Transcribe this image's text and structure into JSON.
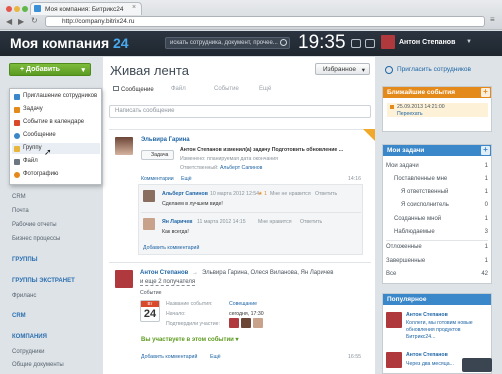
{
  "browser": {
    "tab_title": "Моя компания: Битрикс24",
    "tab_close": "×",
    "url": "http://company.bitrix24.ru",
    "nav_back": "◀",
    "nav_forward": "▶",
    "nav_reload": "↻",
    "menu": "≡"
  },
  "header": {
    "logo_text": "Моя компания",
    "logo_num": "24",
    "search_placeholder": "искать сотрудника, документ, прочее...",
    "clock": "19:35",
    "user_name": "Антон Степанов"
  },
  "left": {
    "add_button": "Добавить",
    "menu_items": [
      "CRM",
      "Почта",
      "Рабочие отчеты",
      "Бизнес процессы"
    ],
    "sections": [
      "ГРУППЫ",
      "ГРУППЫ ЭКСТРАНЕТ",
      "Фриланс",
      "CRM",
      "КОМПАНИЯ",
      "Сотрудники",
      "Общие документы"
    ],
    "dropdown": [
      "Приглашение сотрудников",
      "Задачу",
      "Событие в календаре",
      "Сообщение",
      "Группу",
      "Файл",
      "Фотографию"
    ]
  },
  "main": {
    "title": "Живая лента",
    "fav_button": "Избранное",
    "tabs": [
      "Сообщение",
      "Файл",
      "Событие",
      "Ещё"
    ],
    "message_placeholder": "Написать сообщение",
    "post1": {
      "author": "Эльвира Гарина",
      "tag": "Задача",
      "line1": "Антон Степанов изменил(а) задачу Подготовить обновление ...",
      "line2": "Изменено: планируемая дата окончания",
      "line3_label": "Ответственный:",
      "line3_value": "Альберт Сапинов",
      "actions": "Комментарии",
      "more": "Ещё",
      "time": "14:16"
    },
    "comments": [
      {
        "author": "Альберт Сапинов",
        "date": "10 марта 2012 12:54",
        "likes": "1",
        "meta": "Мне не нравится",
        "reply": "Ответить",
        "text": "Сделаем в лучшем виде!"
      },
      {
        "author": "Ян Ларичев",
        "date": "11 марта 2012 14:15",
        "likes": "",
        "meta": "Мне нравится",
        "reply": "Ответить",
        "text": "Как всегда!"
      }
    ],
    "add_comment": "Добавить комментарий",
    "post2": {
      "author": "Антон Степанов",
      "recipients": "Эльвира Гарина, Олеся Виланова, Ян Ларичев",
      "more_recipients": "и еще 2 получателя",
      "type": "Событие",
      "cal_day_label": "Вт",
      "cal_day": "24",
      "f1_label": "Название события:",
      "f1_value": "Совещание",
      "f2_label": "Начало:",
      "f2_value": "сегодня, 17:30",
      "f3_label": "Подтвердили участие:",
      "participate": "Вы участвуете в этом событии",
      "add_comment": "Добавить комментарий",
      "more": "Ещё",
      "time": "16:55"
    }
  },
  "right": {
    "invite": "Пригласить сотрудников",
    "events_title": "Ближайшие события",
    "event_time": "25.09.2013 14:21:00",
    "event_name": "Переехать",
    "tasks_title": "Мои задачи",
    "tasks": [
      {
        "label": "Мои задачи",
        "count": "1"
      },
      {
        "label": "Поставленные мне",
        "count": "1"
      },
      {
        "label": "Я ответственный",
        "count": "1"
      },
      {
        "label": "Я соисполнитель",
        "count": "0"
      },
      {
        "label": "Созданные мной",
        "count": "1"
      },
      {
        "label": "Наблюдаемые",
        "count": "3"
      },
      {
        "label": "Отложенные",
        "count": "1"
      },
      {
        "label": "Завершенные",
        "count": "1"
      },
      {
        "label": "Все",
        "count": "42"
      }
    ],
    "popular_title": "Популярное",
    "popular": [
      {
        "author": "Антон Степанов",
        "text": "Коллеги, мы готовим новые обновления продуктов Битрикс24..."
      },
      {
        "author": "Антон Степанов",
        "text": "Через два месяца..."
      }
    ]
  },
  "colors": {
    "header": "#232b35",
    "accent": "#49a9ee",
    "green": "#6aaa2e",
    "orange": "#e48a1b",
    "blue": "#3a87c9"
  }
}
